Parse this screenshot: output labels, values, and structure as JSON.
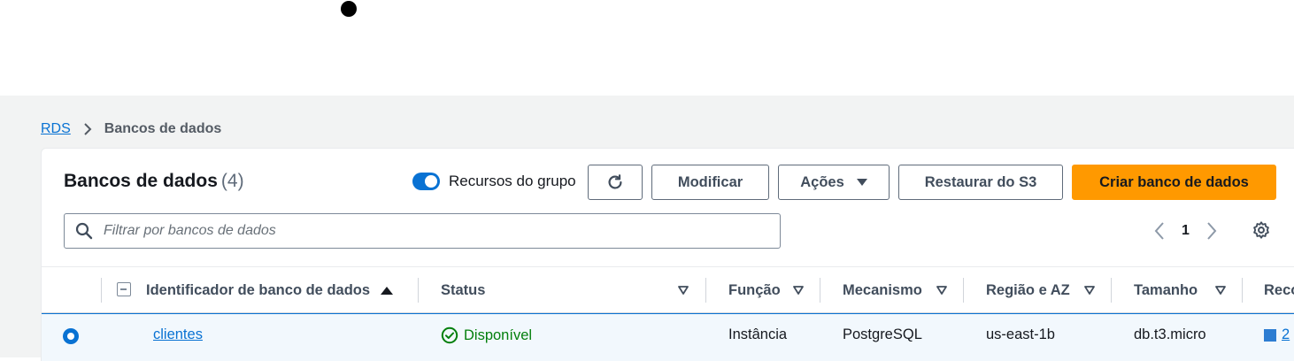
{
  "breadcrumb": {
    "root": "RDS",
    "current": "Bancos de dados"
  },
  "header": {
    "title": "Bancos de dados",
    "count": "(4)"
  },
  "toolbar": {
    "group_toggle_label": "Recursos do grupo",
    "modify_label": "Modificar",
    "actions_label": "Ações",
    "restore_label": "Restaurar do S3",
    "create_label": "Criar banco de dados"
  },
  "search": {
    "placeholder": "Filtrar por bancos de dados"
  },
  "pagination": {
    "current_page": "1"
  },
  "table": {
    "columns": {
      "identifier": "Identificador de banco de dados",
      "status": "Status",
      "role": "Função",
      "engine": "Mecanismo",
      "region": "Região e AZ",
      "size": "Tamanho",
      "recommendations": "Reco"
    },
    "rows": [
      {
        "identifier": "clientes",
        "status": "Disponível",
        "role": "Instância",
        "engine": "PostgreSQL",
        "region": "us-east-1b",
        "size": "db.t3.micro",
        "recommendations": "2"
      }
    ]
  },
  "colors": {
    "accent": "#0972d3",
    "primary_button": "#ff9900",
    "success": "#037f0c",
    "page_bg": "#f2f3f3"
  },
  "icons": [
    "refresh-icon",
    "search-icon",
    "chevron-left-icon",
    "chevron-right-icon",
    "settings-gear-icon",
    "sort-caret-icon",
    "status-ok-icon",
    "caret-down-icon"
  ]
}
